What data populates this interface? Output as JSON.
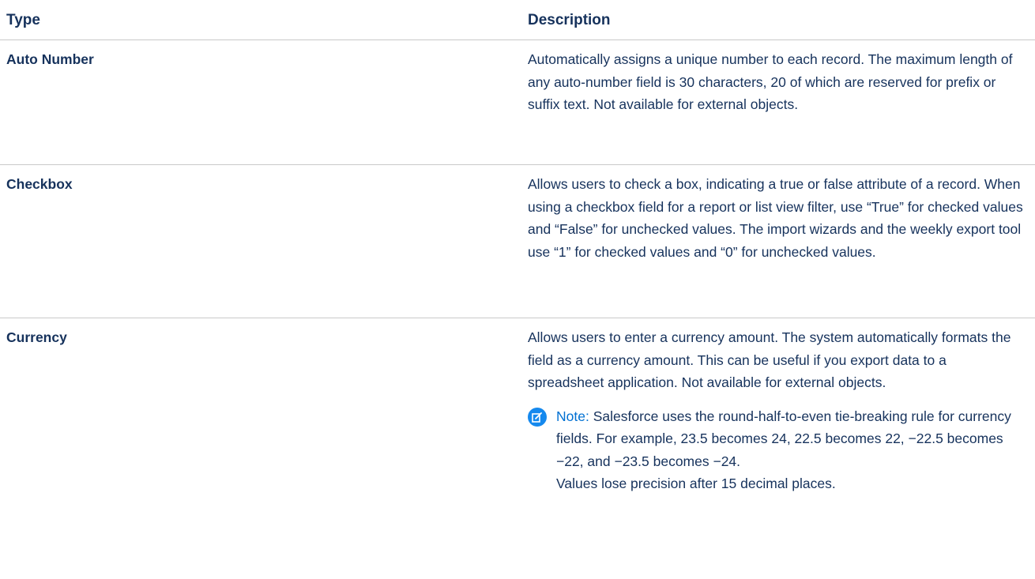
{
  "table": {
    "headers": {
      "type": "Type",
      "description": "Description"
    },
    "rows": [
      {
        "type": "Auto Number",
        "description": "Automatically assigns a unique number to each record. The maximum length of any auto-number field is 30 characters, 20 of which are reserved for prefix or suffix text. Not available for external objects."
      },
      {
        "type": "Checkbox",
        "description": "Allows users to check a box, indicating a true or false attribute of a record. When using a checkbox field for a report or list view filter, use “True” for checked values and “False” for unchecked values. The import wizards and the weekly export tool use “1” for checked values and “0” for unchecked values."
      },
      {
        "type": "Currency",
        "description": "Allows users to enter a currency amount. The system automatically formats the field as a currency amount. This can be useful if you export data to a spreadsheet application. Not available for external objects.",
        "note": {
          "icon": "note-edit-icon",
          "label": "Note:",
          "text": "Salesforce uses the round-half-to-even tie-breaking rule for currency fields. For example, 23.5 becomes 24, 22.5 becomes 22, −22.5 becomes −22, and −23.5 becomes −24.",
          "extra": "Values lose precision after 15 decimal places."
        }
      }
    ]
  },
  "colors": {
    "text": "#16325c",
    "note_label": "#0070d2",
    "note_icon_bg": "#1589ee",
    "divider": "#c9c9c9"
  }
}
